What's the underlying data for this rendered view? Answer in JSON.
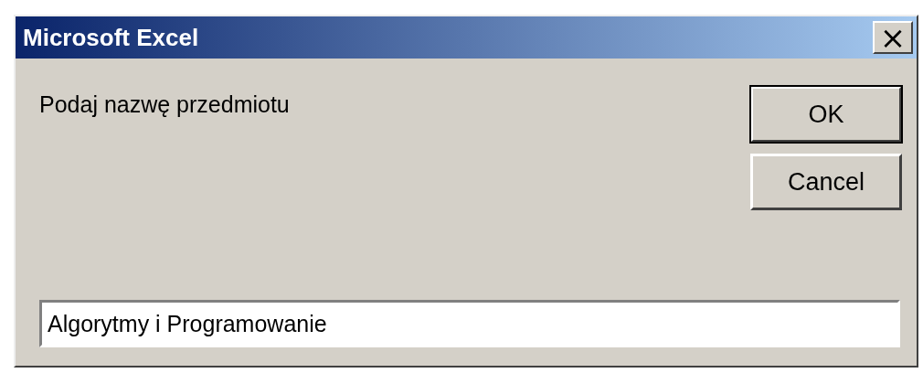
{
  "window": {
    "title": "Microsoft Excel",
    "close": "×"
  },
  "prompt": "Podaj nazwę przedmiotu",
  "buttons": [
    {
      "label": "OK",
      "default": true
    },
    {
      "label": "Cancel",
      "default": false
    }
  ],
  "input": {
    "value": "Algorytmy i Programowanie"
  }
}
